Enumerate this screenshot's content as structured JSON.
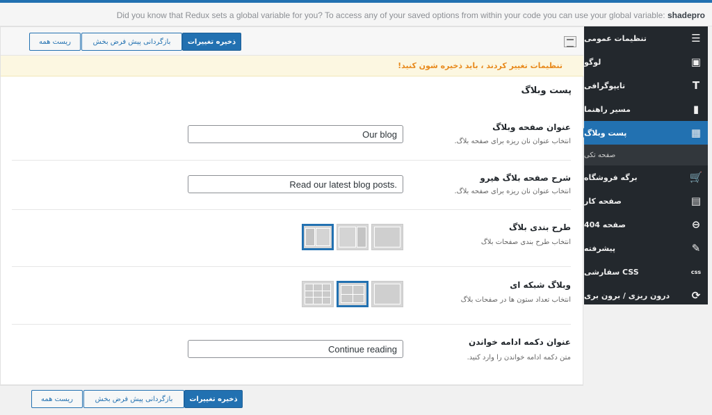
{
  "notice": {
    "text": "Did you know that Redux sets a global variable for you? To access any of your saved options from within your code you can use your global variable:",
    "variable": "shadepro"
  },
  "sidebar": {
    "items": [
      {
        "label": "تنظیمات عمومی",
        "icon": "sliders-icon"
      },
      {
        "label": "لوگو",
        "icon": "image-check-icon"
      },
      {
        "label": "تایپوگرافی",
        "icon": "typography-icon"
      },
      {
        "label": "مسیر راهنما",
        "icon": "bookmark-icon"
      },
      {
        "label": "پست وبلاگ",
        "icon": "grid-icon",
        "active": true
      },
      {
        "label": "برگه فروشگاه",
        "icon": "cart-icon"
      },
      {
        "label": "صفحه کار",
        "icon": "briefcase-icon"
      },
      {
        "label": "صفحه 404",
        "icon": "block-icon"
      },
      {
        "label": "پیشرفته",
        "icon": "edit-icon"
      },
      {
        "label": "CSS سفارشی",
        "icon": "css-icon"
      },
      {
        "label": "درون ریزی / برون بری",
        "icon": "refresh-icon"
      }
    ],
    "sub_item": "صفحه تکی"
  },
  "toolbar": {
    "save": "ذخیره تغییرات",
    "reset_section": "بازگردانی پیش فرض بخش",
    "reset_all": "ریست همه"
  },
  "warning": "تنظیمات تغییر کردند ، باید ذخیره شون کنید!",
  "section_title": "پست وبلاگ",
  "fields": {
    "blog_title": {
      "label": "عنوان صفحه وبلاگ",
      "desc": "انتخاب عنوان نان ریزه برای صفحه بلاگ.",
      "value": "Our blog"
    },
    "blog_hero": {
      "label": "شرح صفحه بلاگ هیرو",
      "desc": "انتخاب عنوان نان ریزه برای صفحه بلاگ.",
      "value": "Read our latest blog posts."
    },
    "layout": {
      "label": "طرح بندی بلاگ",
      "desc": "انتخاب طرح بندی صفحات بلاگ",
      "selected": 1
    },
    "grid": {
      "label": "وبلاگ شبکه ای",
      "desc": "انتخاب تعداد ستون ها در صفحات بلاگ",
      "selected": 2
    },
    "read_more": {
      "label": "عنوان دکمه ادامه خواندن",
      "desc": "متن دکمه ادامه خواندن را وارد کنید.",
      "value": "Continue reading"
    }
  },
  "colors": {
    "accent": "#2271b1",
    "sidebar_bg": "#23282d",
    "warning": "#e88a1d"
  }
}
